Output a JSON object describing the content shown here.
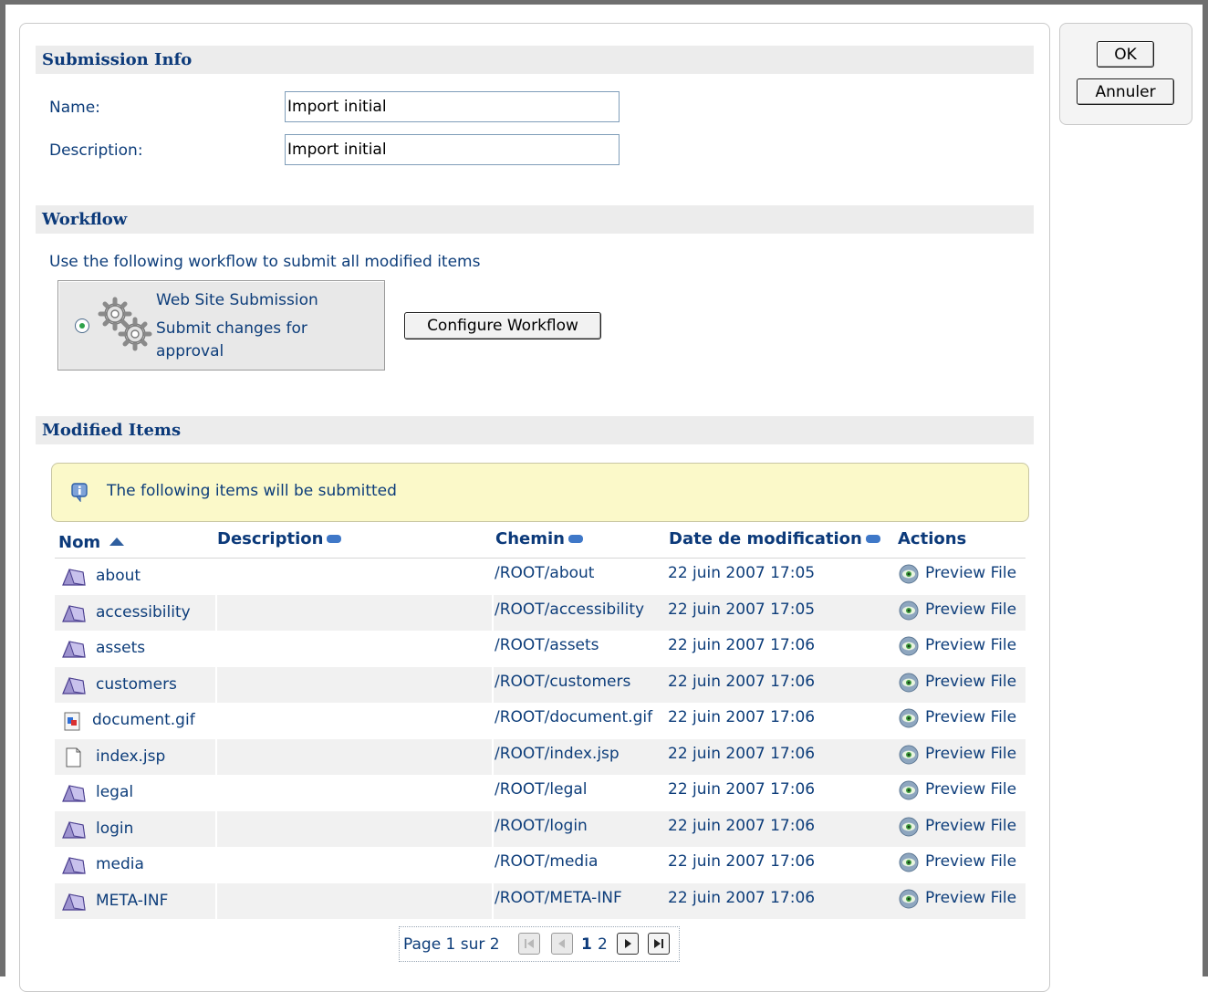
{
  "dialog": {
    "ok_label": "OK",
    "cancel_label": "Annuler"
  },
  "submission_info": {
    "header": "Submission Info",
    "name_label": "Name:",
    "name_value": "Import initial",
    "description_label": "Description:",
    "description_value": "Import initial"
  },
  "workflow": {
    "header": "Workflow",
    "instruction": "Use the following workflow to submit all modified items",
    "option_title": "Web Site Submission",
    "option_desc_line1": "Submit changes for",
    "option_desc_line2": "approval",
    "configure_label": "Configure Workflow"
  },
  "modified_items": {
    "header": "Modified Items",
    "info_text": "The following items will be submitted",
    "columns": {
      "name": "Nom",
      "description": "Description",
      "path": "Chemin",
      "date": "Date de modification",
      "actions": "Actions"
    },
    "rows": [
      {
        "name": "about",
        "icon": "folder-icon",
        "description": "",
        "path": "/ROOT/about",
        "date": "22 juin 2007 17:05",
        "action": "Preview File"
      },
      {
        "name": "accessibility",
        "icon": "folder-icon",
        "description": "",
        "path": "/ROOT/accessibility",
        "date": "22 juin 2007 17:05",
        "action": "Preview File"
      },
      {
        "name": "assets",
        "icon": "folder-icon",
        "description": "",
        "path": "/ROOT/assets",
        "date": "22 juin 2007 17:06",
        "action": "Preview File"
      },
      {
        "name": "customers",
        "icon": "folder-icon",
        "description": "",
        "path": "/ROOT/customers",
        "date": "22 juin 2007 17:06",
        "action": "Preview File"
      },
      {
        "name": "document.gif",
        "icon": "image-file-icon",
        "description": "",
        "path": "/ROOT/document.gif",
        "date": "22 juin 2007 17:06",
        "action": "Preview File"
      },
      {
        "name": "index.jsp",
        "icon": "file-icon",
        "description": "",
        "path": "/ROOT/index.jsp",
        "date": "22 juin 2007 17:06",
        "action": "Preview File"
      },
      {
        "name": "legal",
        "icon": "folder-icon",
        "description": "",
        "path": "/ROOT/legal",
        "date": "22 juin 2007 17:06",
        "action": "Preview File"
      },
      {
        "name": "login",
        "icon": "folder-icon",
        "description": "",
        "path": "/ROOT/login",
        "date": "22 juin 2007 17:06",
        "action": "Preview File"
      },
      {
        "name": "media",
        "icon": "folder-icon",
        "description": "",
        "path": "/ROOT/media",
        "date": "22 juin 2007 17:06",
        "action": "Preview File"
      },
      {
        "name": "META-INF",
        "icon": "folder-icon",
        "description": "",
        "path": "/ROOT/META-INF",
        "date": "22 juin 2007 17:06",
        "action": "Preview File"
      }
    ],
    "pager": {
      "label": "Page 1 sur 2",
      "page1": "1",
      "page2": "2"
    }
  },
  "colors": {
    "header_text": "#0c3a7a",
    "body_text": "#0d3d7a",
    "section_bg": "#ececec",
    "info_bg": "#fbf9c9",
    "alt_row_bg": "#f1f1f1"
  }
}
